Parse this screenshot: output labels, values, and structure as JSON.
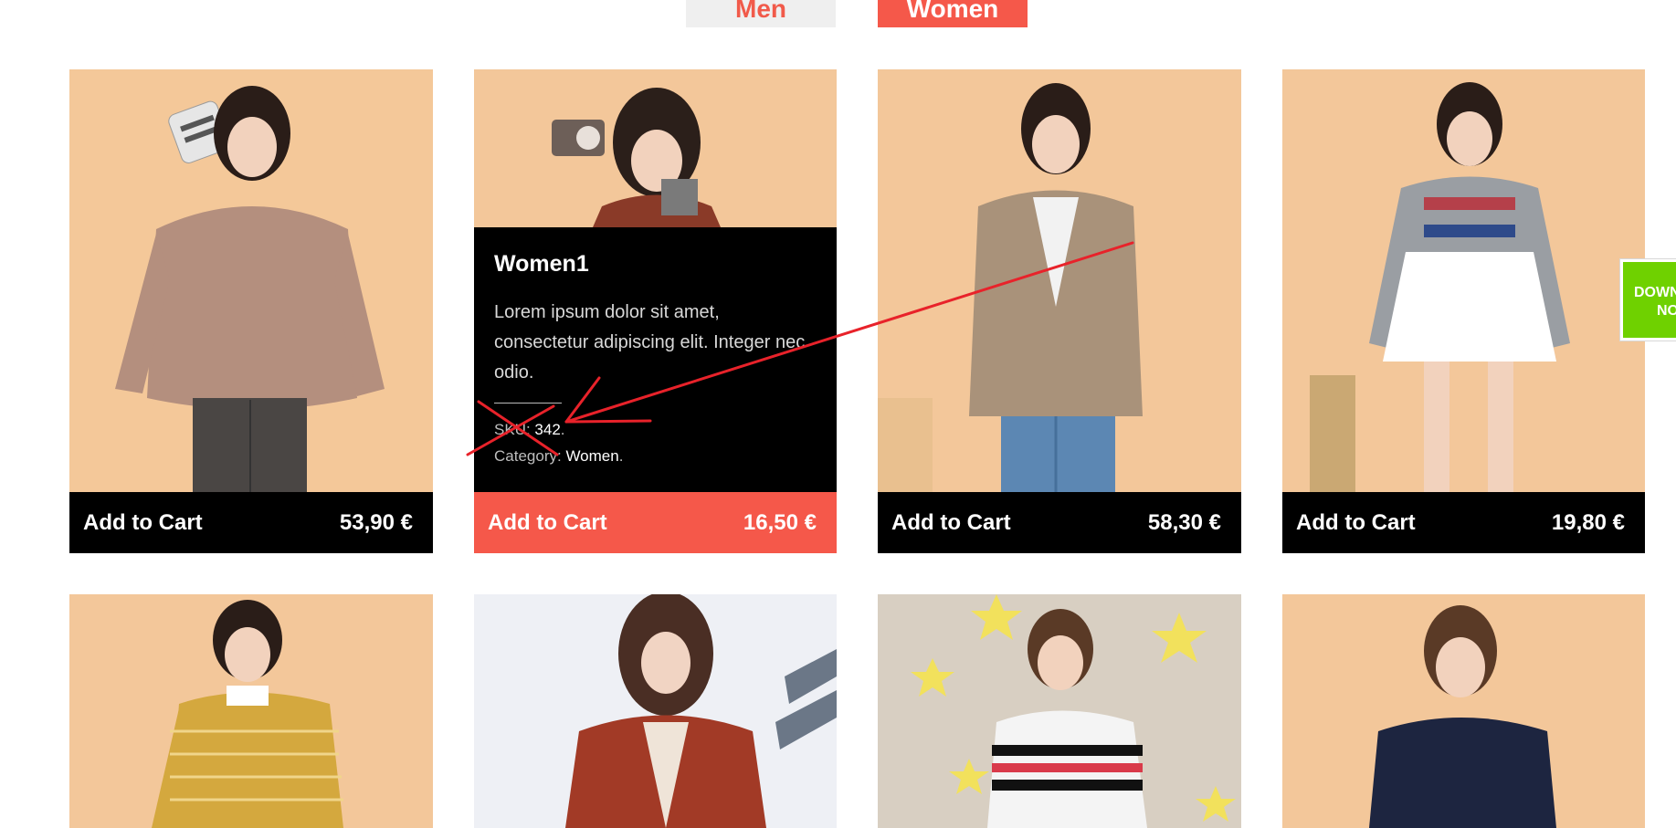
{
  "filters": {
    "men": "Men",
    "women": "Women"
  },
  "products": [
    {
      "add_label": "Add to Cart",
      "price": "53,90 €"
    },
    {
      "add_label": "Add to Cart",
      "price": "16,50 €",
      "name": "Women1",
      "description": "Lorem ipsum dolor sit amet, consectetur adipiscing elit. Integer nec odio.",
      "sku_label": "SKU:",
      "sku": "342",
      "category_label": "Category:",
      "category": "Women"
    },
    {
      "add_label": "Add to Cart",
      "price": "58,30 €"
    },
    {
      "add_label": "Add to Cart",
      "price": "19,80 €"
    }
  ],
  "download_badge": {
    "line1": "DOWNL",
    "line2": "NOW"
  },
  "colors": {
    "accent": "#f5584a",
    "bar": "#000000",
    "download": "#6fd100"
  }
}
